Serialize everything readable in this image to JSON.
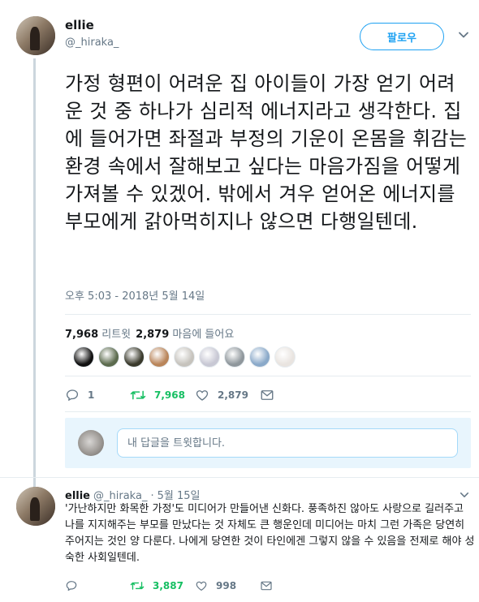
{
  "tweet": {
    "author_name": "ellie",
    "author_handle": "@_hiraka_",
    "follow_label": "팔로우",
    "text": "가정 형편이 어려운 집 아이들이 가장 얻기 어려운 것 중 하나가 심리적 에너지라고 생각한다. 집에 들어가면 좌절과 부정의 기운이 온몸을 휘감는 환경 속에서 잘해보고 싶다는 마음가짐을 어떻게 가져볼 수 있겠어. 밖에서 겨우 얻어온 에너지를 부모에게 갉아먹히지나 않으면 다행일텐데.",
    "timestamp": "오후 5:03 - 2018년 5월 14일",
    "retweet_count": "7,968",
    "retweet_label": "리트윗",
    "like_count": "2,879",
    "like_label": "마음에 들어요",
    "liker_colors": [
      "#111111",
      "#5c6b4e",
      "#3a3a2c",
      "#b9855a",
      "#c6c3bd",
      "#c8c8d4",
      "#8f979c",
      "#8aa9c9",
      "#e9e4e0"
    ],
    "actions": {
      "reply_count": "1",
      "retweet_count": "7,968",
      "like_count": "2,879"
    },
    "accent_color": "#1da1f2",
    "retweet_color": "#17bf63"
  },
  "reply_box": {
    "placeholder": "내 답글을 트윗합니다."
  },
  "reply_tweet": {
    "author_name": "ellie",
    "author_handle": "@_hiraka_",
    "dot": "·",
    "date": "5월 15일",
    "text": "'가난하지만 화목한 가정'도 미디어가 만들어낸 신화다. 풍족하진 않아도 사랑으로 길러주고 나를 지지해주는 부모를 만났다는 것 자체도 큰 행운인데 미디어는 마치 그런 가족은 당연히 주어지는 것인 양 다룬다. 나에게 당연한 것이 타인에겐 그렇지 않을 수 있음을 전제로 해야 성숙한 사회일텐데.",
    "retweet_count": "3,887",
    "like_count": "998"
  },
  "icons": {
    "reply": "reply-icon",
    "retweet": "retweet-icon",
    "like": "heart-icon",
    "dm": "envelope-icon",
    "more": "chevron-down-icon"
  }
}
